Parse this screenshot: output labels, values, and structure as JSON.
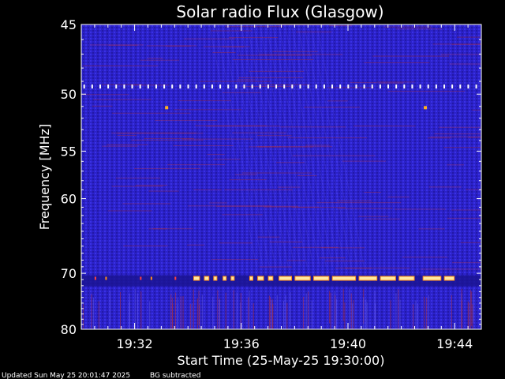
{
  "chart_data": {
    "type": "heatmap",
    "title": "Solar radio Flux (Glasgow)",
    "xlabel": "Start Time (25-May-25 19:30:00)",
    "ylabel": "Frequency [MHz]",
    "x_ticks": [
      {
        "label": "19:32",
        "minute": 2
      },
      {
        "label": "19:36",
        "minute": 6
      },
      {
        "label": "19:40",
        "minute": 10
      },
      {
        "label": "19:44",
        "minute": 14
      }
    ],
    "xlim_minutes": [
      0,
      15
    ],
    "y_ticks": [
      {
        "label": "45",
        "mhz": 45
      },
      {
        "label": "50",
        "mhz": 50
      },
      {
        "label": "55",
        "mhz": 55
      },
      {
        "label": "60",
        "mhz": 60
      },
      {
        "label": "70",
        "mhz": 70
      },
      {
        "label": "80",
        "mhz": 80
      }
    ],
    "ylim_mhz": [
      45,
      80
    ],
    "y_scale": "reciprocal",
    "colors": {
      "background_band": "#2a1fc0",
      "noise": "#3b2ae0",
      "red_streak": "#c0302a",
      "burst": "#ffe9a0",
      "burst_edge": "#ff8c1a",
      "frame": "#ffffff"
    },
    "features": [
      {
        "name": "interference_line",
        "mhz": 49.4,
        "minute_start": 0,
        "minute_end": 15
      },
      {
        "name": "interference_band",
        "mhz": 70.8,
        "minute_start": 4.2,
        "minute_end": 14.0
      },
      {
        "name": "spot",
        "mhz": 51.1,
        "minute": 3.2
      },
      {
        "name": "spot",
        "mhz": 51.1,
        "minute": 12.9
      }
    ],
    "footer_left": "Updated Sun May 25 20:01:47 2025",
    "footer_right": "BG subtracted"
  }
}
